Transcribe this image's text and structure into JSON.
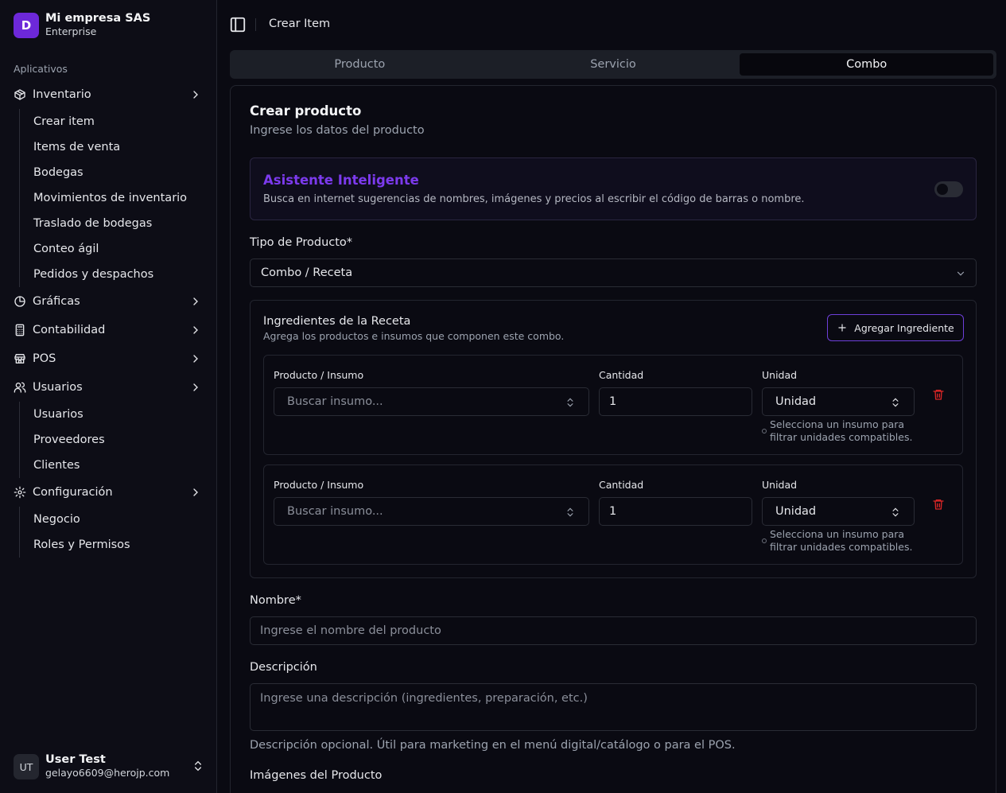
{
  "org": {
    "logo_letter": "D",
    "name": "Mi empresa SAS",
    "plan": "Enterprise"
  },
  "sidebar": {
    "section_label": "Aplicativos",
    "inventario": {
      "label": "Inventario",
      "icon": "package-icon",
      "items": [
        "Crear item",
        "Items de venta",
        "Bodegas",
        "Movimientos de inventario",
        "Traslado de bodegas",
        "Conteo ágil",
        "Pedidos y despachos"
      ]
    },
    "graficas": {
      "label": "Gráficas",
      "icon": "pie-chart-icon"
    },
    "contabilidad": {
      "label": "Contabilidad",
      "icon": "calculator-icon"
    },
    "pos": {
      "label": "POS",
      "icon": "store-icon"
    },
    "usuarios": {
      "label": "Usuarios",
      "icon": "users-icon",
      "items": [
        "Usuarios",
        "Proveedores",
        "Clientes"
      ]
    },
    "configuracion": {
      "label": "Configuración",
      "icon": "gear-icon",
      "items": [
        "Negocio",
        "Roles y Permisos"
      ]
    }
  },
  "user": {
    "initials": "UT",
    "name": "User Test",
    "email": "gelayo6609@herojp.com"
  },
  "header": {
    "breadcrumb": "Crear Item"
  },
  "tabs": [
    "Producto",
    "Servicio",
    "Combo"
  ],
  "active_tab": "Combo",
  "form": {
    "title": "Crear producto",
    "subtitle": "Ingrese los datos del producto",
    "assistant": {
      "title": "Asistente Inteligente",
      "description": "Busca en internet sugerencias de nombres, imágenes y precios al escribir el código de barras o nombre.",
      "enabled": false
    },
    "product_type": {
      "label": "Tipo de Producto*",
      "value": "Combo / Receta"
    },
    "recipe": {
      "title": "Ingredientes de la Receta",
      "subtitle": "Agrega los productos e insumos que componen este combo.",
      "add_button": "Agregar Ingrediente",
      "rows": [
        {
          "product_label": "Producto / Insumo",
          "product_placeholder": "Buscar insumo...",
          "qty_label": "Cantidad",
          "qty_value": "1",
          "unit_label": "Unidad",
          "unit_value": "Unidad",
          "hint": "Selecciona un insumo para filtrar unidades compatibles."
        },
        {
          "product_label": "Producto / Insumo",
          "product_placeholder": "Buscar insumo...",
          "qty_label": "Cantidad",
          "qty_value": "1",
          "unit_label": "Unidad",
          "unit_value": "Unidad",
          "hint": "Selecciona un insumo para filtrar unidades compatibles."
        }
      ]
    },
    "name": {
      "label": "Nombre*",
      "placeholder": "Ingrese el nombre del producto"
    },
    "description": {
      "label": "Descripción",
      "placeholder": "Ingrese una descripción (ingredientes, preparación, etc.)",
      "help": "Descripción opcional. Útil para marketing en el menú digital/catálogo o para el POS."
    },
    "images": {
      "label": "Imágenes del Producto"
    }
  },
  "colors": {
    "accent": "#7c3aed",
    "danger": "#dc2626",
    "background": "#0a0a12"
  }
}
